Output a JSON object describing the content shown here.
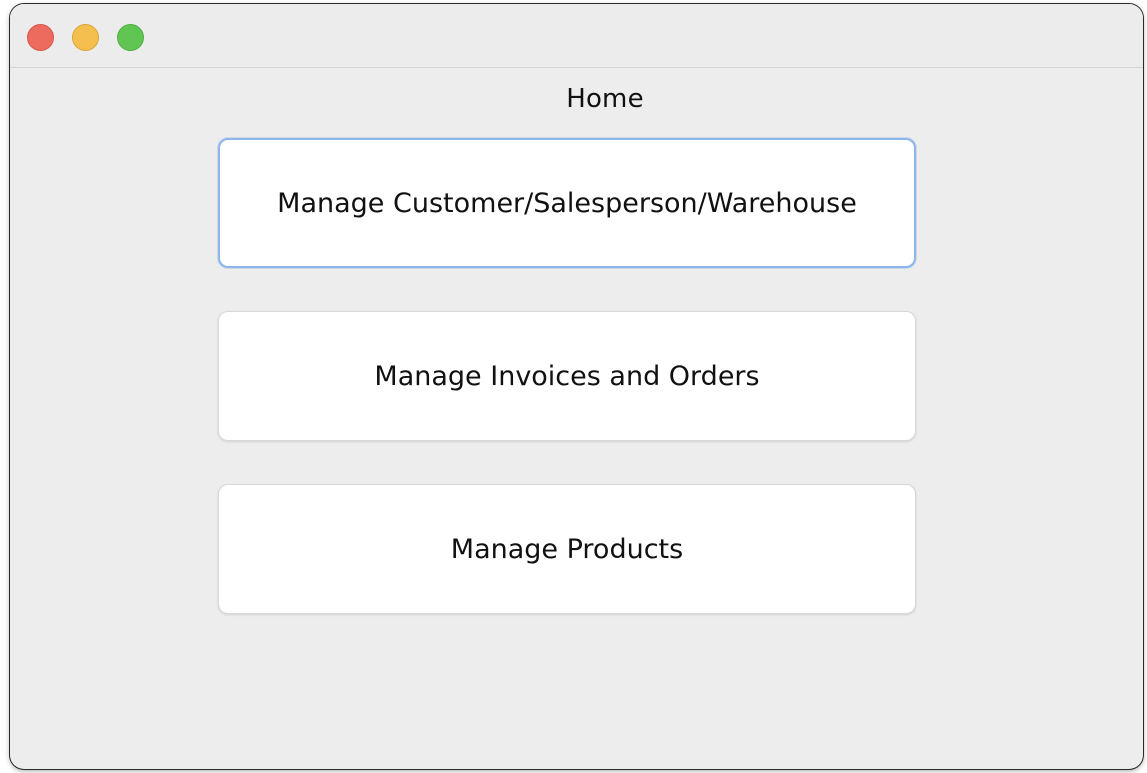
{
  "window": {
    "controls": [
      "close",
      "minimize",
      "zoom"
    ],
    "colors": {
      "close": "#ec6a5e",
      "minimize": "#f4bf4f",
      "zoom": "#61c554",
      "focus_ring": "#8fb6ea"
    }
  },
  "page": {
    "title": "Home"
  },
  "buttons": [
    {
      "label": "Manage Customer/Salesperson/Warehouse",
      "focused": true
    },
    {
      "label": "Manage Invoices and Orders",
      "focused": false
    },
    {
      "label": "Manage Products",
      "focused": false
    }
  ]
}
